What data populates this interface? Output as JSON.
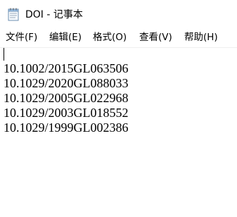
{
  "window": {
    "title": "DOI - 记事本",
    "icon": "notepad-icon"
  },
  "menu": {
    "items": [
      {
        "label": "文件(F)"
      },
      {
        "label": "编辑(E)"
      },
      {
        "label": "格式(O)"
      },
      {
        "label": "查看(V)"
      },
      {
        "label": "帮助(H)"
      }
    ]
  },
  "editor": {
    "lines": [
      "",
      "10.1002/2015GL063506",
      "10.1029/2020GL088033",
      "10.1029/2005GL022968",
      "10.1029/2003GL018552",
      "10.1029/1999GL002386"
    ]
  }
}
